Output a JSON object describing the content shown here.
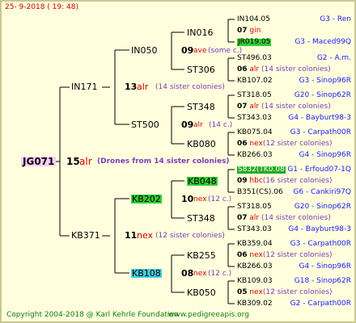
{
  "header": {
    "date": "25-  9-2018 ( 19: 48)"
  },
  "root": {
    "name": "JG071",
    "num": "15",
    "mark": "alr",
    "note": "(Drones from 14 sister colonies)"
  },
  "gen1": [
    {
      "name": "IN171",
      "num": "13",
      "mark": "alr",
      "note": "(14 sister colonies)"
    },
    {
      "name": "KB371",
      "num": "11",
      "mark": "nex",
      "note": "(12 sister colonies)"
    }
  ],
  "gen2": [
    {
      "name": "IN050",
      "num": "09",
      "mark": "ave",
      "note": "(some c.)"
    },
    {
      "name": "ST500",
      "num": "09",
      "mark": "alr",
      "note": "(14 c.)"
    },
    {
      "name": "KB202",
      "num": "10",
      "mark": "nex",
      "note": "(12 c.)"
    },
    {
      "name": "KB108",
      "num": "08",
      "mark": "nex",
      "note": "(12 c.)"
    }
  ],
  "gen3": [
    {
      "name": "IN016",
      "num": "07",
      "mark": "gin",
      "note": ""
    },
    {
      "name": "ST306",
      "num": "06",
      "mark": "alr",
      "note": "(14 sister colonies)"
    },
    {
      "name": "ST348",
      "num": "07",
      "mark": "alr",
      "note": "(14 sister colonies)"
    },
    {
      "name": "KB080",
      "num": "06",
      "mark": "nex",
      "note": "(12 sister colonies)"
    },
    {
      "name": "KB048",
      "num": "09",
      "mark": "hbc",
      "note": "(16 sister colonies)"
    },
    {
      "name": "ST348",
      "num": "07",
      "mark": "alr",
      "note": "(14 sister colonies)"
    },
    {
      "name": "KB255",
      "num": "06",
      "mark": "nex",
      "note": "(12 sister colonies)"
    },
    {
      "name": "KB050",
      "num": "05",
      "mark": "nex",
      "note": "(12 sister colonies)"
    }
  ],
  "gen4": [
    {
      "name": "IN104.05",
      "origin": "G3 - Ren"
    },
    {
      "name": "JR019.05",
      "origin": "G3 - Maced99Q"
    },
    {
      "name": "ST496.03",
      "origin": "G2 - A.m."
    },
    {
      "name": "KB107.02",
      "origin": "G3 - Sinop96R"
    },
    {
      "name": "ST318.05",
      "origin": "G20 - Sinop62R"
    },
    {
      "name": "ST343.03",
      "origin": "G4 - Bayburt98-3"
    },
    {
      "name": "KB075.04",
      "origin": "G3 - Carpath00R"
    },
    {
      "name": "KB266.03",
      "origin": "G4 - Sinop96R"
    },
    {
      "name": "S832(TK0.08",
      "origin": "G1 - Erfoud07-1Q"
    },
    {
      "name": "B351(CS).06",
      "origin": "G6 - Cankiri97Q"
    },
    {
      "name": "ST318.05",
      "origin": "G20 - Sinop62R"
    },
    {
      "name": "ST343.03",
      "origin": "G4 - Bayburt98-3"
    },
    {
      "name": "KB359.04",
      "origin": "G3 - Carpath00R"
    },
    {
      "name": "KB266.03",
      "origin": "G4 - Sinop96R"
    },
    {
      "name": "KB109.03",
      "origin": "G18 - Sinop62R"
    },
    {
      "name": "KB309.02",
      "origin": "G2 - Carpath00R"
    }
  ],
  "footer": {
    "copyright": "Copyright 2004-2018 @ Karl Kehrle Foundation",
    "url": "www.pedigreeapis.org"
  }
}
